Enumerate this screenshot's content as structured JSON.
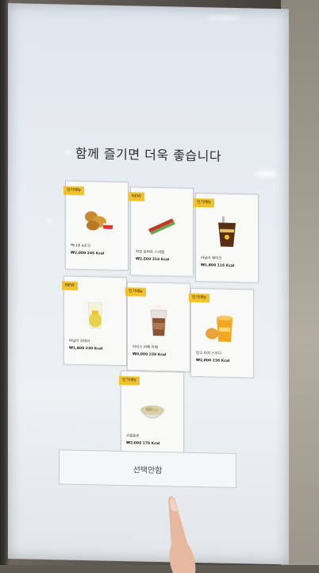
{
  "header": {
    "title": "함께 즐기면 더욱 좋습니다"
  },
  "items": [
    {
      "badge": "인기메뉴",
      "name": "맥너겟 4조각",
      "price": "₩2,000",
      "kcal": "245 Kcal",
      "icon": "nuggets-icon"
    },
    {
      "badge": "NEW",
      "name": "치킨 토마토 스낵랩",
      "price": "₩2,500",
      "kcal": "314 Kcal",
      "icon": "snack-wrap-icon"
    },
    {
      "badge": "인기메뉴",
      "name": "바닐라 쉐이크",
      "price": "₩1,800",
      "kcal": "116 Kcal",
      "icon": "shake-icon"
    },
    {
      "badge": "NEW",
      "name": "바닐라 선데이",
      "price": "₩1,800",
      "kcal": "230 Kcal",
      "icon": "sundae-icon"
    },
    {
      "badge": "인기메뉴",
      "name": "아이스 카페 라떼",
      "price": "₩4,000",
      "kcal": "239 Kcal",
      "icon": "iced-latte-icon"
    },
    {
      "badge": "인기메뉴",
      "name": "망고 피치 스무디",
      "price": "₩2,800",
      "kcal": "236 Kcal",
      "icon": "mango-smoothie-icon"
    },
    {
      "badge": "인기메뉴",
      "name": "코울슬로",
      "price": "₩2,000",
      "kcal": "170 Kcal",
      "icon": "coleslaw-icon"
    }
  ],
  "actions": {
    "no_thanks": "선택안함"
  }
}
